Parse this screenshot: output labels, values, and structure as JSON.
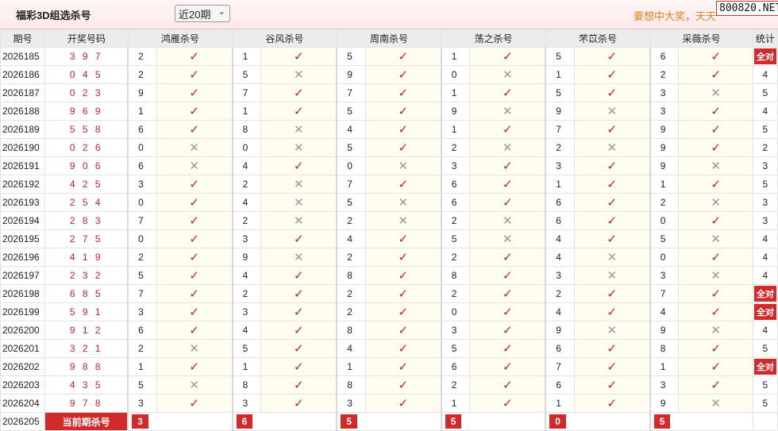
{
  "header": {
    "title": "福彩3D组选杀号",
    "period_select": "近20期",
    "promo": "要想中大奖，天天",
    "watermark": "800820.NET"
  },
  "columns": {
    "issue": "期号",
    "draw": "开奖号码",
    "experts": [
      "鸿雁杀号",
      "谷风杀号",
      "周南杀号",
      "荡之杀号",
      "芣苡杀号",
      "采薇杀号"
    ],
    "stat": "统计"
  },
  "rows": [
    {
      "issue": "2026185",
      "draw": "3 9 7",
      "kills": [
        [
          2,
          1
        ],
        [
          1,
          1
        ],
        [
          5,
          1
        ],
        [
          1,
          1
        ],
        [
          5,
          1
        ],
        [
          6,
          1
        ]
      ],
      "stat": "全对"
    },
    {
      "issue": "2026186",
      "draw": "0 4 5",
      "kills": [
        [
          2,
          1
        ],
        [
          5,
          0
        ],
        [
          9,
          1
        ],
        [
          0,
          0
        ],
        [
          1,
          1
        ],
        [
          2,
          1
        ]
      ],
      "stat": "4"
    },
    {
      "issue": "2026187",
      "draw": "0 2 3",
      "kills": [
        [
          9,
          1
        ],
        [
          7,
          1
        ],
        [
          7,
          1
        ],
        [
          1,
          1
        ],
        [
          5,
          1
        ],
        [
          3,
          0
        ]
      ],
      "stat": "5"
    },
    {
      "issue": "2026188",
      "draw": "9 6 9",
      "kills": [
        [
          1,
          1
        ],
        [
          1,
          1
        ],
        [
          5,
          1
        ],
        [
          9,
          0
        ],
        [
          9,
          0
        ],
        [
          3,
          1
        ]
      ],
      "stat": "4"
    },
    {
      "issue": "2026189",
      "draw": "5 5 8",
      "kills": [
        [
          6,
          1
        ],
        [
          8,
          0
        ],
        [
          4,
          1
        ],
        [
          1,
          1
        ],
        [
          7,
          1
        ],
        [
          9,
          1
        ]
      ],
      "stat": "5"
    },
    {
      "issue": "2026190",
      "draw": "0 2 6",
      "kills": [
        [
          0,
          0
        ],
        [
          0,
          0
        ],
        [
          5,
          1
        ],
        [
          2,
          0
        ],
        [
          2,
          0
        ],
        [
          9,
          1
        ]
      ],
      "stat": "2"
    },
    {
      "issue": "2026191",
      "draw": "9 0 6",
      "kills": [
        [
          6,
          0
        ],
        [
          4,
          1
        ],
        [
          0,
          0
        ],
        [
          3,
          1
        ],
        [
          3,
          1
        ],
        [
          9,
          0
        ]
      ],
      "stat": "3"
    },
    {
      "issue": "2026192",
      "draw": "4 2 5",
      "kills": [
        [
          3,
          1
        ],
        [
          2,
          0
        ],
        [
          7,
          1
        ],
        [
          6,
          1
        ],
        [
          1,
          1
        ],
        [
          1,
          1
        ]
      ],
      "stat": "5"
    },
    {
      "issue": "2026193",
      "draw": "2 5 4",
      "kills": [
        [
          0,
          1
        ],
        [
          4,
          0
        ],
        [
          5,
          0
        ],
        [
          6,
          1
        ],
        [
          6,
          1
        ],
        [
          2,
          0
        ]
      ],
      "stat": "3"
    },
    {
      "issue": "2026194",
      "draw": "2 8 3",
      "kills": [
        [
          7,
          1
        ],
        [
          2,
          0
        ],
        [
          2,
          0
        ],
        [
          2,
          0
        ],
        [
          6,
          1
        ],
        [
          0,
          1
        ]
      ],
      "stat": "3"
    },
    {
      "issue": "2026195",
      "draw": "2 7 5",
      "kills": [
        [
          0,
          1
        ],
        [
          3,
          1
        ],
        [
          4,
          1
        ],
        [
          5,
          0
        ],
        [
          4,
          1
        ],
        [
          5,
          0
        ]
      ],
      "stat": "4"
    },
    {
      "issue": "2026196",
      "draw": "4 1 9",
      "kills": [
        [
          2,
          1
        ],
        [
          9,
          0
        ],
        [
          2,
          1
        ],
        [
          2,
          1
        ],
        [
          4,
          0
        ],
        [
          0,
          1
        ]
      ],
      "stat": "4"
    },
    {
      "issue": "2026197",
      "draw": "2 3 2",
      "kills": [
        [
          5,
          1
        ],
        [
          4,
          1
        ],
        [
          8,
          1
        ],
        [
          8,
          1
        ],
        [
          3,
          0
        ],
        [
          3,
          0
        ]
      ],
      "stat": "4"
    },
    {
      "issue": "2026198",
      "draw": "6 8 5",
      "kills": [
        [
          7,
          1
        ],
        [
          2,
          1
        ],
        [
          2,
          1
        ],
        [
          2,
          1
        ],
        [
          2,
          1
        ],
        [
          7,
          1
        ]
      ],
      "stat": "全对"
    },
    {
      "issue": "2026199",
      "draw": "5 9 1",
      "kills": [
        [
          3,
          1
        ],
        [
          3,
          1
        ],
        [
          2,
          1
        ],
        [
          0,
          1
        ],
        [
          4,
          1
        ],
        [
          4,
          1
        ]
      ],
      "stat": "全对"
    },
    {
      "issue": "2026200",
      "draw": "9 1 2",
      "kills": [
        [
          6,
          1
        ],
        [
          4,
          1
        ],
        [
          8,
          1
        ],
        [
          3,
          1
        ],
        [
          9,
          0
        ],
        [
          9,
          0
        ]
      ],
      "stat": "4"
    },
    {
      "issue": "2026201",
      "draw": "3 2 1",
      "kills": [
        [
          2,
          0
        ],
        [
          5,
          1
        ],
        [
          4,
          1
        ],
        [
          5,
          1
        ],
        [
          6,
          1
        ],
        [
          8,
          1
        ]
      ],
      "stat": "5"
    },
    {
      "issue": "2026202",
      "draw": "9 8 8",
      "kills": [
        [
          1,
          1
        ],
        [
          1,
          1
        ],
        [
          1,
          1
        ],
        [
          6,
          1
        ],
        [
          7,
          1
        ],
        [
          1,
          1
        ]
      ],
      "stat": "全对"
    },
    {
      "issue": "2026203",
      "draw": "4 3 5",
      "kills": [
        [
          5,
          0
        ],
        [
          8,
          1
        ],
        [
          8,
          1
        ],
        [
          2,
          1
        ],
        [
          6,
          1
        ],
        [
          3,
          1
        ]
      ],
      "stat": "5"
    },
    {
      "issue": "2026204",
      "draw": "9 7 8",
      "kills": [
        [
          3,
          1
        ],
        [
          3,
          1
        ],
        [
          3,
          1
        ],
        [
          1,
          1
        ],
        [
          1,
          1
        ],
        [
          9,
          0
        ]
      ],
      "stat": "5"
    }
  ],
  "current": {
    "issue": "2026205",
    "label": "当前期杀号",
    "kills": [
      "3",
      "6",
      "5",
      "5",
      "0",
      "5"
    ]
  },
  "icons": {
    "ok": "✓",
    "bad": "✕"
  },
  "colors": {
    "accent_red": "#d12a2a",
    "promo_orange": "#e8801e",
    "cell_bg": "#fffdf0"
  }
}
